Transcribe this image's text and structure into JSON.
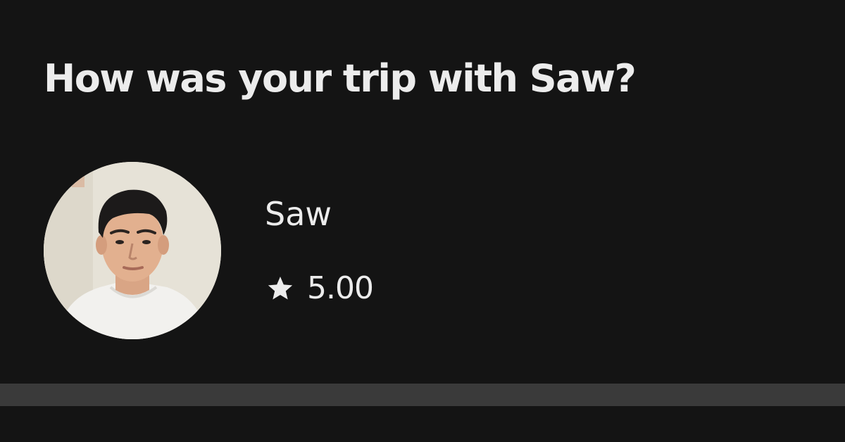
{
  "rating_prompt": {
    "question": "How was your trip with Saw?"
  },
  "driver": {
    "name": "Saw",
    "rating": "5.00",
    "rating_icon": "star-icon",
    "avatar_icon": "driver-photo"
  },
  "colors": {
    "background": "#141414",
    "text": "#ececec",
    "divider": "#3a3a3a"
  }
}
